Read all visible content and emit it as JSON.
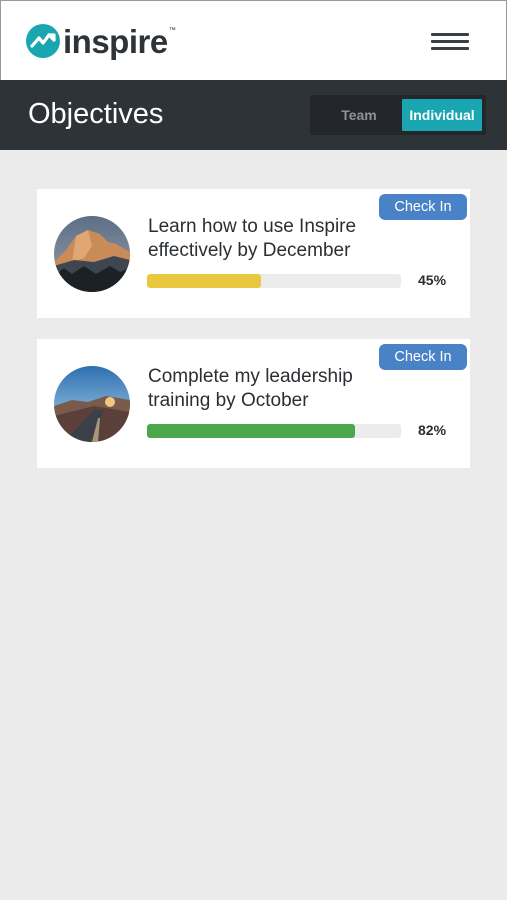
{
  "header": {
    "logo_text": "inspire",
    "logo_tm": "™",
    "brand_color": "#1aa6b0",
    "menu_icon": "hamburger-menu-icon"
  },
  "titlebar": {
    "title": "Objectives",
    "toggle": {
      "options": [
        "Team",
        "Individual"
      ],
      "selected": "Individual"
    }
  },
  "objectives": [
    {
      "title": "Learn how to use Inspire effectively by December",
      "progress": 45,
      "progress_label": "45%",
      "progress_color": "#e8c83e",
      "checkin_label": "Check In",
      "avatar": "mountain-landscape-image"
    },
    {
      "title": "Complete my leadership training by October",
      "progress": 82,
      "progress_label": "82%",
      "progress_color": "#4aa84a",
      "checkin_label": "Check In",
      "avatar": "road-sunset-landscape-image"
    }
  ]
}
